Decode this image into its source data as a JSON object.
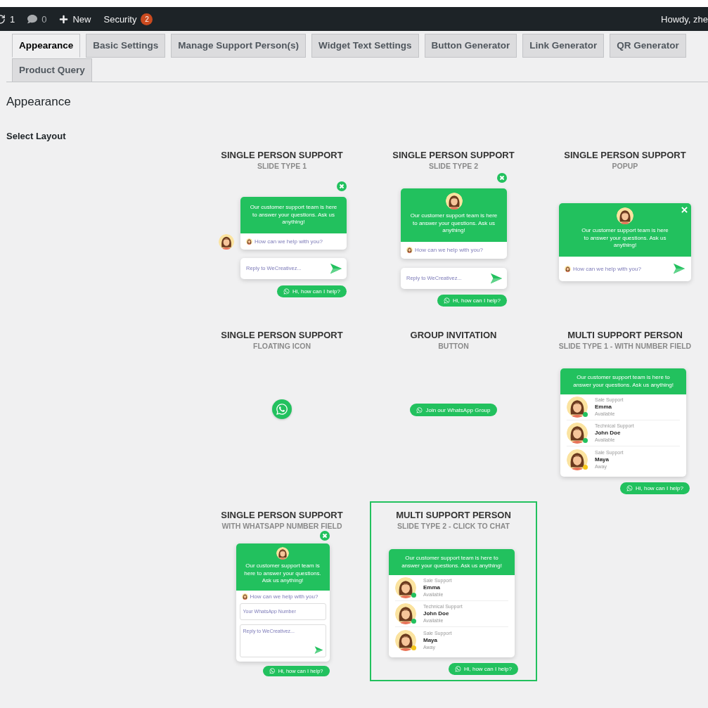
{
  "admin_bar": {
    "updates": "1",
    "comments": "0",
    "new": "New",
    "security": "Security",
    "security_count": "2",
    "greeting": "Howdy, zhe"
  },
  "tabs": [
    {
      "label": "Appearance",
      "selected": true
    },
    {
      "label": "Basic Settings",
      "selected": false
    },
    {
      "label": "Manage Support Person(s)",
      "selected": false
    },
    {
      "label": "Widget Text Settings",
      "selected": false
    },
    {
      "label": "Button Generator",
      "selected": false
    },
    {
      "label": "Link Generator",
      "selected": false
    },
    {
      "label": "QR Generator",
      "selected": false
    },
    {
      "label": "Product Query",
      "selected": false
    }
  ],
  "heading": "Appearance",
  "section_label": "Select Layout",
  "layouts": [
    {
      "kind": "slide1",
      "title": "SINGLE PERSON SUPPORT",
      "subtitle": "SLIDE TYPE 1",
      "selected": false,
      "message": "Our customer support team is here to answer your questions. Ask us anything!",
      "prompt": "How can we help with you?",
      "reply_placeholder": "Reply to WeCreativez...",
      "button": "Hi, how can I help?"
    },
    {
      "kind": "slide2",
      "title": "SINGLE PERSON SUPPORT",
      "subtitle": "SLIDE TYPE 2",
      "selected": false,
      "message": "Our customer support team is here to answer your questions. Ask us anything!",
      "prompt": "How can we help with you?",
      "reply_placeholder": "Reply to WeCreativez...",
      "button": "Hi, how can I help?"
    },
    {
      "kind": "popup",
      "title": "SINGLE PERSON SUPPORT",
      "subtitle": "POPUP",
      "selected": false,
      "message": "Our customer support team is here to answer your questions. Ask us anything!",
      "prompt": "How can we help with you?"
    },
    {
      "kind": "floating",
      "title": "SINGLE PERSON SUPPORT",
      "subtitle": "FLOATING ICON",
      "selected": false
    },
    {
      "kind": "group",
      "title": "GROUP INVITATION",
      "subtitle": "BUTTON",
      "selected": false,
      "button": "Join our WhatsApp Group"
    },
    {
      "kind": "multi",
      "title": "MULTI SUPPORT PERSON",
      "subtitle": "SLIDE TYPE 1 - WITH NUMBER FIELD",
      "selected": false,
      "message": "Our customer support team is here to answer your questions. Ask us anything!",
      "button": "Hi, how can I help?",
      "persons": [
        {
          "role": "Sale Support",
          "name": "Emma",
          "status": "Available",
          "color": "#22c15e"
        },
        {
          "role": "Technical Support",
          "name": "John Doe",
          "status": "Available",
          "color": "#22c15e"
        },
        {
          "role": "Sale Support",
          "name": "Maya",
          "status": "Away",
          "color": "#f5c518"
        }
      ]
    },
    {
      "kind": "number",
      "title": "SINGLE PERSON SUPPORT",
      "subtitle": "WITH WHATSAPP NUMBER FIELD",
      "selected": false,
      "message": "Our customer support team is here to answer your questions. Ask us anything!",
      "prompt": "How can we help with you?",
      "number_placeholder": "Your WhatsApp Number",
      "reply_placeholder": "Reply to WeCreativez...",
      "button": "Hi, how can I help?"
    },
    {
      "kind": "multi",
      "title": "MULTI SUPPORT PERSON",
      "subtitle": "SLIDE TYPE 2 - CLICK TO CHAT",
      "selected": true,
      "message": "Our customer support team is here to answer your questions. Ask us anything!",
      "button": "Hi, how can I help?",
      "persons": [
        {
          "role": "Sale Support",
          "name": "Emma",
          "status": "Available",
          "color": "#22c15e"
        },
        {
          "role": "Technical Support",
          "name": "John Doe",
          "status": "Available",
          "color": "#22c15e"
        },
        {
          "role": "Sale Support",
          "name": "Maya",
          "status": "Away",
          "color": "#f5c518"
        }
      ]
    }
  ]
}
